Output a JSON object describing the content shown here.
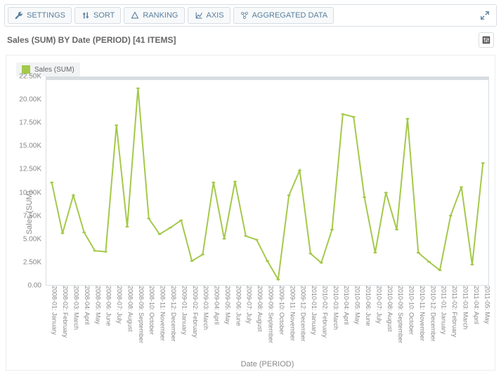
{
  "toolbar": {
    "settings": "SETTINGS",
    "sort": "SORT",
    "ranking": "RANKING",
    "axis": "AXIS",
    "aggregated": "AGGREGATED DATA"
  },
  "title": "Sales (SUM) BY Date (PERIOD) [41 ITEMS]",
  "legend_label": "Sales (SUM)",
  "y_axis_label": "Sales (SUM)",
  "x_axis_label": "Date (PERIOD)",
  "chart_data": {
    "type": "line",
    "title": "Sales (SUM) BY Date (PERIOD) [41 ITEMS]",
    "legend": [
      "Sales (SUM)"
    ],
    "xlabel": "Date (PERIOD)",
    "ylabel": "Sales (SUM)",
    "ylim": [
      0,
      22500
    ],
    "y_ticks": [
      0,
      2500,
      5000,
      7500,
      10000,
      12500,
      15000,
      17500,
      20000,
      22500
    ],
    "y_tick_labels": [
      "0.00",
      "2.50K",
      "5.00K",
      "7.50K",
      "10.00K",
      "12.50K",
      "15.00K",
      "17.50K",
      "20.00K",
      "22.50K"
    ],
    "categories": [
      "2008-01: January",
      "2008-02: February",
      "2008-03: March",
      "2008-04: April",
      "2008-05: May",
      "2008-06: June",
      "2008-07: July",
      "2008-08: August",
      "2008-09: September",
      "2008-10: October",
      "2008-11: November",
      "2008-12: December",
      "2009-01: January",
      "2009-02: February",
      "2009-03: March",
      "2009-04: April",
      "2009-05: May",
      "2009-06: June",
      "2009-07: July",
      "2009-08: August",
      "2009-09: September",
      "2009-10: October",
      "2009-11: November",
      "2009-12: December",
      "2010-01: January",
      "2010-02: February",
      "2010-03: March",
      "2010-04: April",
      "2010-05: May",
      "2010-06: June",
      "2010-07: July",
      "2010-08: August",
      "2010-09: September",
      "2010-10: October",
      "2010-11: November",
      "2010-12: December",
      "2011-01: January",
      "2011-02: February",
      "2011-03: March",
      "2011-04: April",
      "2011-05: May"
    ],
    "series": [
      {
        "name": "Sales (SUM)",
        "values": [
          11100,
          5600,
          9700,
          5700,
          3700,
          3600,
          17300,
          6300,
          21300,
          7200,
          5500,
          6200,
          7000,
          2600,
          3300,
          11100,
          5000,
          11200,
          5300,
          4900,
          2600,
          600,
          9700,
          12400,
          3400,
          2400,
          6000,
          18500,
          18200,
          9500,
          3500,
          10000,
          6000,
          18000,
          3500,
          2500,
          1600,
          7500,
          10600,
          2200,
          13200
        ]
      }
    ]
  }
}
